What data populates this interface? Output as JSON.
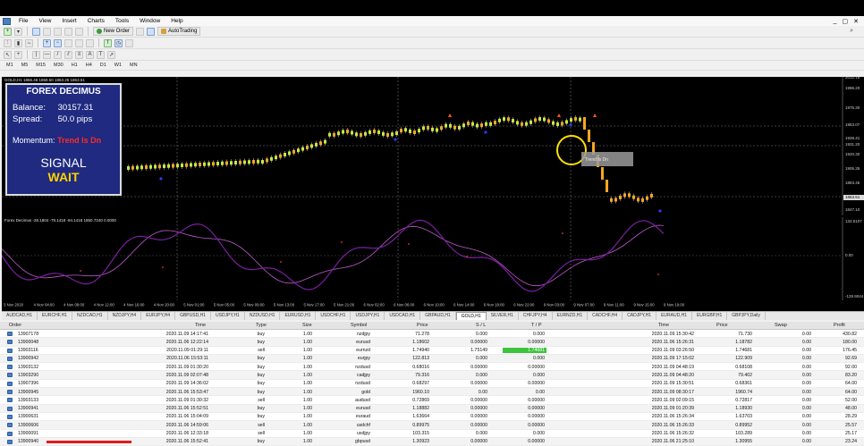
{
  "menu": [
    "File",
    "View",
    "Insert",
    "Charts",
    "Tools",
    "Window",
    "Help"
  ],
  "window_controls": [
    "_",
    "▢",
    "✕"
  ],
  "toolbar": {
    "new_order": "New Order",
    "autotrading": "AutoTrading"
  },
  "timeframes": [
    "M1",
    "M5",
    "M15",
    "M30",
    "H1",
    "H4",
    "D1",
    "W1",
    "MN"
  ],
  "chart": {
    "header": "GOLD,H1  1866.46 1869.50 1863.26 1863.51",
    "indicator_header": "Forex Decimus -26.1804 -79.1418 -94.1418 1850.7240 0.0000",
    "tooltip": "Trend Is Dn",
    "price_labels": [
      "2012.15",
      "1996.20",
      "1975.30",
      "1953.07",
      "1938.41",
      "1931.20",
      "1920.30",
      "1905.35",
      "1883.45",
      "1863.51",
      "1847.10"
    ],
    "indicator_labels": [
      "133.5107",
      "0.00",
      "-129.9044"
    ],
    "dates": [
      "3 Nov 2020",
      "4 Nov 04:00",
      "4 Nov 08:00",
      "4 Nov 12:00",
      "4 Nov 16:00",
      "4 Nov 20:00",
      "5 Nov 01:00",
      "5 Nov 05:00",
      "5 Nov 09:00",
      "5 Nov 13:00",
      "5 Nov 17:00",
      "5 Nov 21:00",
      "6 Nov 02:00",
      "6 Nov 06:00",
      "6 Nov 10:00",
      "6 Nov 14:00",
      "6 Nov 18:00",
      "6 Nov 22:00",
      "9 Nov 03:00",
      "9 Nov 07:00",
      "9 Nov 11:00",
      "9 Nov 15:00",
      "9 Nov 19:00"
    ]
  },
  "panel": {
    "title": "FOREX DECIMUS",
    "balance_label": "Balance:",
    "balance_value": "30157.31",
    "spread_label": "Spread:",
    "spread_value": "50.0 pips",
    "momentum_label": "Momentum:",
    "momentum_value": "Trend Is Dn",
    "signal_label": "SIGNAL",
    "signal_value": "WAIT"
  },
  "symbol_tabs": [
    "AUDCAD,H1",
    "EURCHF,H1",
    "NZDCAD,H1",
    "NZDJPY,H4",
    "EURJPY,H4",
    "GBPUSD,H1",
    "USDJPY,H1",
    "NZDUSD,H1",
    "EURUSD,H1",
    "USDCHF,H1",
    "USDJPY,H1",
    "USDCAD,H1",
    "GBPAUD,H1",
    "GOLD,H1",
    "SILVER,H1",
    "CHFJPY,H4",
    "EURNZD,H1",
    "CADCHF,H4",
    "CADJPY,H1",
    "EURAUD,H1",
    "EURGBP,H1",
    "GBPJPY,Daily"
  ],
  "active_symbol_tab": "GOLD,H1",
  "terminal": {
    "headers": [
      "Order",
      "Time",
      "Type",
      "Size",
      "Symbol",
      "Price",
      "S / L",
      "T / P",
      "Time",
      "Price",
      "Swap",
      "Profit"
    ],
    "rows": [
      [
        "13907178",
        "2020.11.09 14:17:41",
        "buy",
        "1.00",
        "nzdjpy",
        "71.278",
        "0.000",
        "0.000",
        "2020.11.09 15:30:42",
        "71.730",
        "0.00",
        "430.82"
      ],
      [
        "13900048",
        "2020.11.06 12:22:14",
        "buy",
        "1.00",
        "eurusd",
        "1.18602",
        "0.00000",
        "0.00000",
        "2020.11.06 15:26:31",
        "1.18782",
        "0.00",
        "180.00"
      ],
      [
        "13903116",
        "2020.11.09 01:29:11",
        "sell",
        "1.00",
        "eurnzd",
        "1.74940",
        "1.75149",
        "1.74681",
        "2020.11.09 03:26:50",
        "1.74681",
        "0.00",
        "176.45"
      ],
      [
        "13900942",
        "2020.11.06 15:53:11",
        "buy",
        "1.00",
        "eurjpy",
        "122.813",
        "0.000",
        "0.000",
        "2020.11.09 17:15:02",
        "122.909",
        "0.00",
        "92.69"
      ],
      [
        "13903132",
        "2020.11.09 01:30:20",
        "buy",
        "1.00",
        "nzdusd",
        "0.68016",
        "0.00000",
        "0.00000",
        "2020.11.09 04:48:19",
        "0.68108",
        "0.00",
        "92.00"
      ],
      [
        "13903290",
        "2020.11.09 02:07:48",
        "buy",
        "1.00",
        "cadjpy",
        "79.316",
        "0.000",
        "0.000",
        "2020.11.09 04:48:20",
        "79.402",
        "0.00",
        "83.20"
      ],
      [
        "13907396",
        "2020.11.09 14:36:02",
        "buy",
        "1.00",
        "nzdusd",
        "0.68297",
        "0.00000",
        "0.00000",
        "2020.11.09 15:30:51",
        "0.68361",
        "0.00",
        "64.00"
      ],
      [
        "13900945",
        "2020.11.06 15:53:47",
        "buy",
        "1.00",
        "gold",
        "1960.10",
        "0.00",
        "0.00",
        "2020.11.09 08:30:17",
        "1960.74",
        "0.00",
        "64.00"
      ],
      [
        "13903133",
        "2020.11.09 01:30:32",
        "sell",
        "1.00",
        "audusd",
        "0.72869",
        "0.00000",
        "0.00000",
        "2020.11.09 02:09:15",
        "0.72817",
        "0.00",
        "52.00"
      ],
      [
        "13900941",
        "2020.11.06 15:52:51",
        "buy",
        "1.00",
        "eurusd",
        "1.18882",
        "0.00000",
        "0.00000",
        "2020.11.09 01:20:39",
        "1.18930",
        "0.00",
        "48.00"
      ],
      [
        "13900631",
        "2020.11.06 15:04:09",
        "buy",
        "1.00",
        "euraud",
        "1.63664",
        "0.00000",
        "0.00000",
        "2020.11.06 15:26:34",
        "1.63703",
        "0.00",
        "28.29"
      ],
      [
        "13900606",
        "2020.11.06 14:59:06",
        "sell",
        "1.00",
        "usdchf",
        "0.89975",
        "0.00000",
        "0.00000",
        "2020.11.06 15:26:33",
        "0.89952",
        "0.00",
        "25.57"
      ],
      [
        "13900091",
        "2020.11.06 12:33:18",
        "sell",
        "1.00",
        "usdjpy",
        "103.315",
        "0.000",
        "0.000",
        "2020.11.06 15:26:32",
        "103.289",
        "0.00",
        "25.17"
      ],
      [
        "13900940",
        "2020.11.06 15:52:41",
        "buy",
        "1.00",
        "gbpusd",
        "1.30923",
        "0.00000",
        "0.00000",
        "2020.11.06 21:25:10",
        "1.30955",
        "0.00",
        "23.24"
      ]
    ]
  },
  "colors": {
    "bull_candle": "#c8e63c",
    "bear_candle": "#f5a623",
    "indicator_line": "#7a1fa0",
    "signal_line": "#c05ad0",
    "panel_bg": "#1f2a80",
    "tp_highlight": "#3cc43c"
  }
}
